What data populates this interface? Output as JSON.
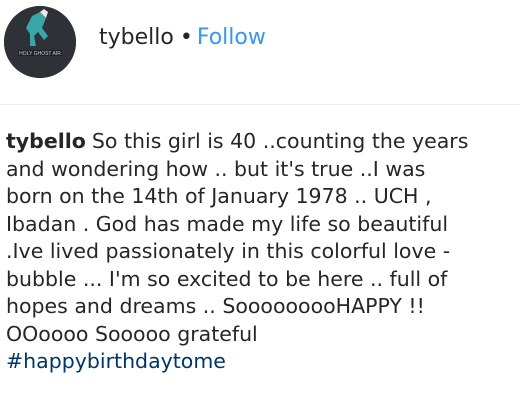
{
  "header": {
    "username": "tybello",
    "separator": "•",
    "follow_label": "Follow",
    "avatar_logo_text": "HOLY GHOST AIR"
  },
  "caption": {
    "username": "tybello",
    "lines": [
      "So this girl is 40 ..counting the years",
      "and wondering how .. but it's true ..I was",
      "born on the 14th of January 1978 .. UCH ,",
      "Ibadan . God has made my life so beautiful",
      ".Ive lived passionately in this colorful love -",
      "bubble ... I'm so excited to be here .. full of",
      "hopes and dreams .. SooooooooHAPPY !!",
      "OOoooo Sooooo grateful"
    ],
    "hashtag": "#happybirthdaytome"
  },
  "colors": {
    "link_blue": "#3897f0",
    "hashtag_blue": "#003569",
    "text": "#262626"
  }
}
